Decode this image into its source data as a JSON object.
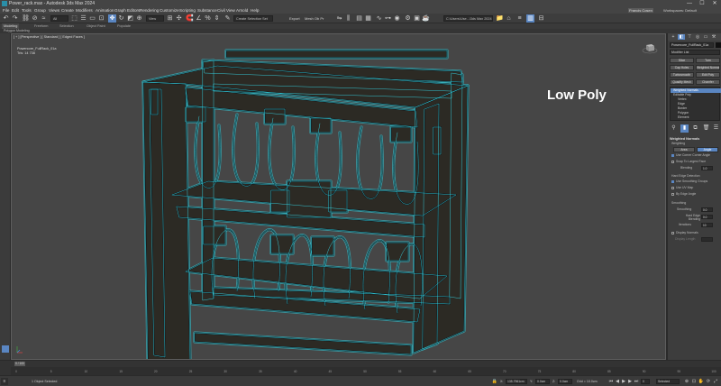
{
  "app": {
    "title": "Power_rack.max - Autodesk 3ds Max 2024",
    "window_buttons": [
      "—",
      "☐",
      "✕"
    ]
  },
  "menu": {
    "items": [
      "File",
      "Edit",
      "Tools",
      "Group",
      "Views",
      "Create",
      "Modifiers",
      "Animation",
      "Graph Editors",
      "Rendering",
      "Customize",
      "Scripting",
      "Substance",
      "Civil View",
      "Arnold",
      "Help"
    ],
    "sign_in": "Francis Cosen",
    "workspace": "Workspaces: Default"
  },
  "toolbar": {
    "selection_filter": "All",
    "selection_set": "Create Selection Set",
    "view_dropdown": "View",
    "export_label": "Export",
    "layer_label": "Mesh Ob Pr",
    "project_path": "C:\\Users\\Use...\\3ds Max 2024",
    "active_tool": "select-move"
  },
  "ribbon": {
    "tabs": [
      "Modeling",
      "Freeform",
      "Selection",
      "Object Paint",
      "Populate"
    ],
    "active_tab": "Modeling",
    "sub_label": "Polygon Modeling"
  },
  "viewport": {
    "label": "[ + ] [Perspective ] [ Standard ] [ Edged Faces ]",
    "stats_object": "Powercore_FullRack_01a",
    "stats_tris": "Tris:     14 738",
    "caption": "Low Poly",
    "wire_color": "#35d8e8"
  },
  "command_panel": {
    "object_name": "Powercore_FullRack_01a",
    "modifier_list": "Modifier List",
    "buttons": [
      "Slice",
      "Turn",
      "Cap Holes",
      "Weighted Normals",
      "Turbosmooth",
      "Edit Poly",
      "Quadify Mesh",
      "Chamfer",
      "Symmetry"
    ],
    "stack": [
      "Weighted Normals",
      "Editable Poly",
      "Vertex",
      "Edge",
      "Border",
      "Polygon",
      "Element"
    ],
    "rollout_title": "Weighted Normals",
    "weighting_label": "Weighting",
    "weighting_options": [
      "Area",
      "Angle"
    ],
    "use_corner_label": "Use Corner Corner Angle",
    "snap_label": "Snap To Largest Face",
    "blending_label": "Blending",
    "blending_value": "1.0",
    "hard_edge_label": "Hard Edge Detection",
    "smoothing_groups_label": "Use Smoothing Groups",
    "use_uv_label": "Use UV Map",
    "by_edge_angle_label": "By Edge Angle",
    "smoothing_label": "Smoothing",
    "smoothing_value": "0.0",
    "hard_edge_blend_label": "Hard Edge Blending",
    "hard_edge_blend_value": "0.0",
    "iterations_label": "Iterations",
    "iterations_value": "10",
    "display_normals_label": "Display Normals",
    "display_length_label": "Display Length"
  },
  "timeline": {
    "current": "0 / 100",
    "ticks": [
      "0",
      "5",
      "10",
      "15",
      "20",
      "25",
      "30",
      "35",
      "40",
      "45",
      "50",
      "55",
      "60",
      "65",
      "70",
      "75",
      "80",
      "85",
      "90",
      "95",
      "100"
    ]
  },
  "status": {
    "selection": "1 Object Selected",
    "x_value": "135.7961cm",
    "y_value": "0.0cm",
    "z_value": "0.0cm",
    "grid": "Grid = 10.0cm",
    "selected_dropdown": "Selected",
    "add_time_tag": "Add Time Tag",
    "frame": "0"
  }
}
